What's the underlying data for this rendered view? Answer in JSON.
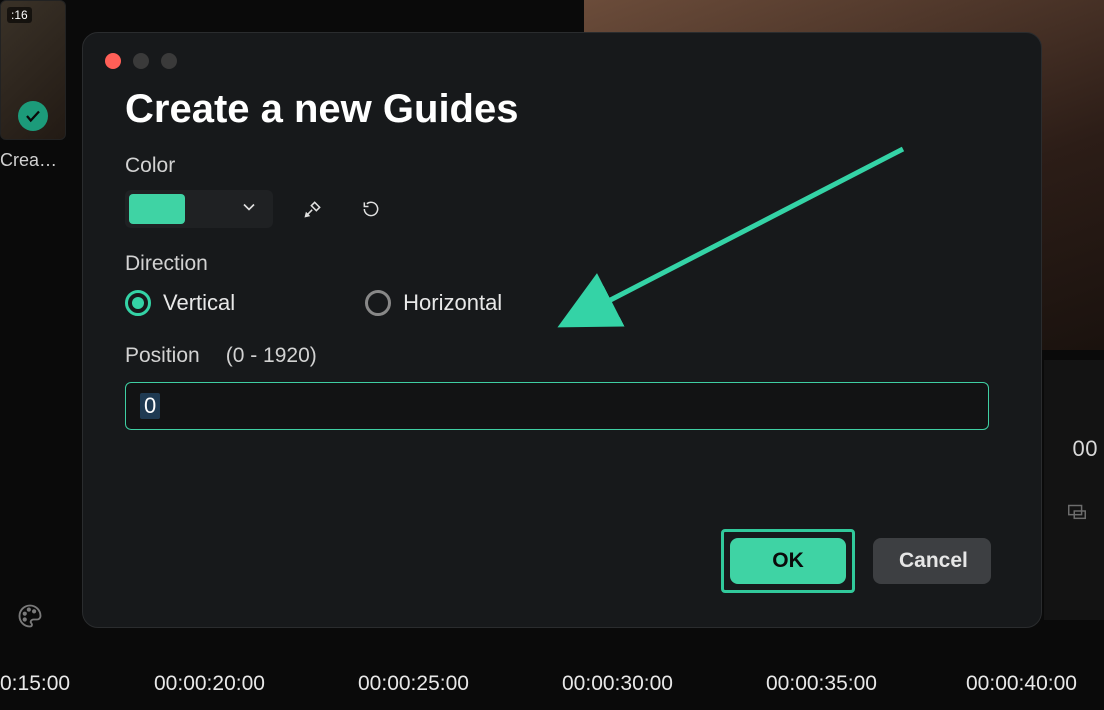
{
  "bg": {
    "clip_time": ":16",
    "clip_label": "Crea…",
    "right_time": "00"
  },
  "timeline": {
    "ticks": [
      "0:15:00",
      "00:00:20:00",
      "00:00:25:00",
      "00:00:30:00",
      "00:00:35:00",
      "00:00:40:00"
    ]
  },
  "modal": {
    "title": "Create a new Guides",
    "color_label": "Color",
    "color_value": "#3fd3a4",
    "direction_label": "Direction",
    "direction_options": {
      "vertical": "Vertical",
      "horizontal": "Horizontal"
    },
    "direction_selected": "vertical",
    "position_label": "Position",
    "position_range": "(0 - 1920)",
    "position_value": "0",
    "ok_label": "OK",
    "cancel_label": "Cancel"
  }
}
